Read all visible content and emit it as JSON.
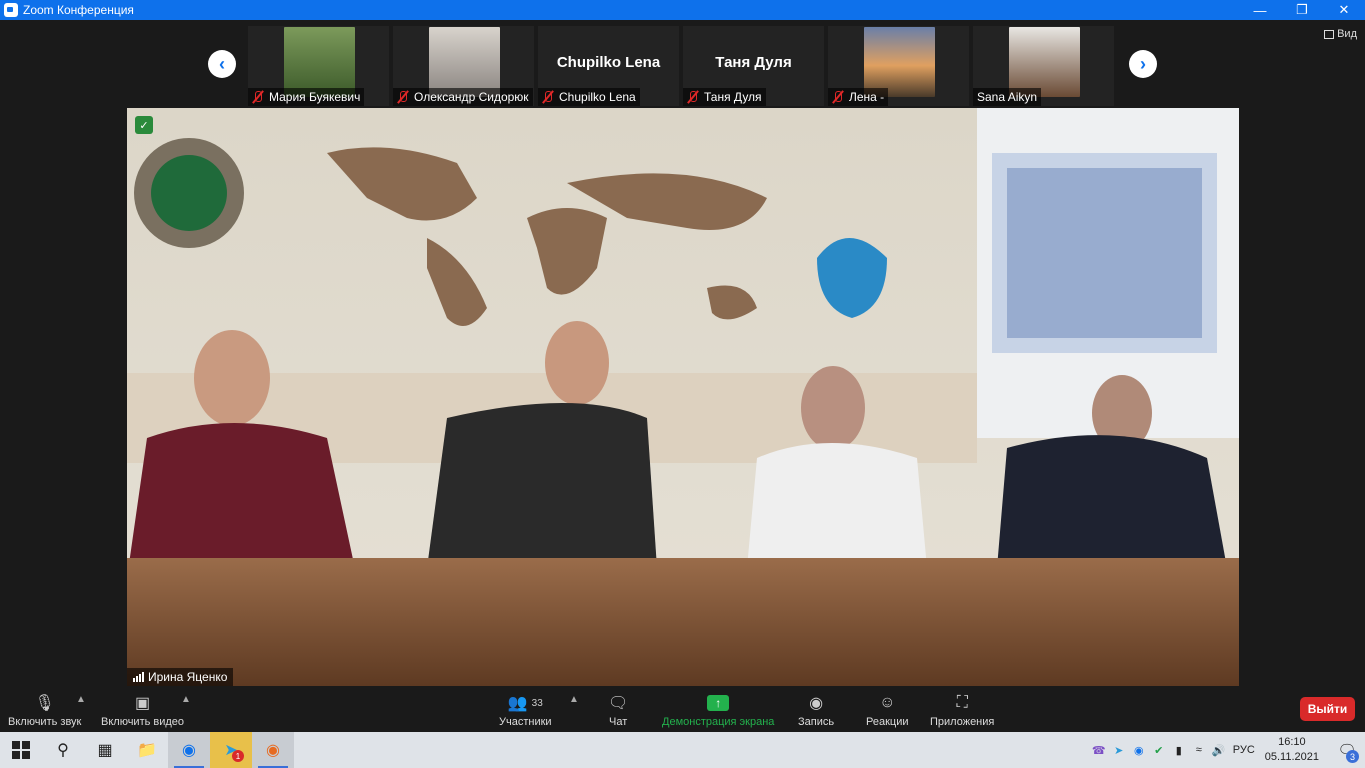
{
  "window": {
    "title": "Zoom Конференция"
  },
  "gallery": {
    "view_label": "Вид",
    "tiles": [
      {
        "name": "Мария Буякевич",
        "has_photo": true,
        "photo_color": "#4d6b3a"
      },
      {
        "name": "Олександр Сидорюк",
        "has_photo": true,
        "photo_color": "#b9b0a4"
      },
      {
        "name": "Chupilko Lena",
        "has_photo": false,
        "display_name": "Chupilko Lena"
      },
      {
        "name": "Таня Дуля",
        "has_photo": false,
        "display_name": "Таня Дуля"
      },
      {
        "name": "Лена -",
        "has_photo": true,
        "photo_color": "#8a6a52"
      },
      {
        "name": "Sana Aikyn",
        "has_photo": true,
        "photo_color": "#7a5a44"
      }
    ]
  },
  "main_video": {
    "speaker_name": "Ирина Яценко"
  },
  "toolbar": {
    "unmute_label": "Включить звук",
    "start_video_label": "Включить видео",
    "participants_label": "Участники",
    "participants_count": "33",
    "chat_label": "Чат",
    "share_label": "Демонстрация экрана",
    "record_label": "Запись",
    "reactions_label": "Реакции",
    "apps_label": "Приложения",
    "leave_label": "Выйти"
  },
  "taskbar": {
    "language": "РУС",
    "time": "16:10",
    "date": "05.11.2021",
    "notifications_count": "3",
    "telegram_badge": "1"
  },
  "colors": {
    "zoom_blue": "#0e71eb",
    "share_green": "#23b14d",
    "leave_red": "#d92a2a",
    "mute_red": "#e02828"
  }
}
